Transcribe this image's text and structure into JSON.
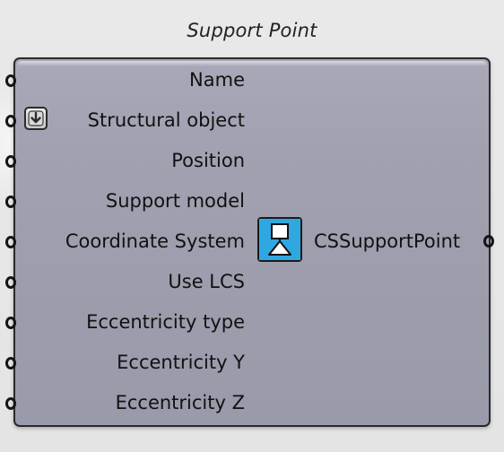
{
  "component": {
    "title": "Support Point",
    "inputs": [
      {
        "label": "Name"
      },
      {
        "label": "Structural object"
      },
      {
        "label": "Position"
      },
      {
        "label": "Support model"
      },
      {
        "label": "Coordinate System"
      },
      {
        "label": "Use LCS"
      },
      {
        "label": "Eccentricity type"
      },
      {
        "label": "Eccentricity Y"
      },
      {
        "label": "Eccentricity Z"
      }
    ],
    "outputs": [
      {
        "label": "CSSupportPoint"
      }
    ],
    "icons": {
      "component_icon": "support-point-icon",
      "structural_object_badge": "down-arrow-icon"
    },
    "colors": {
      "canvas": "#e7e7e7",
      "body": "#a1a1b1",
      "border": "#2a2a2a",
      "icon_blue": "#2fa8e2"
    }
  }
}
